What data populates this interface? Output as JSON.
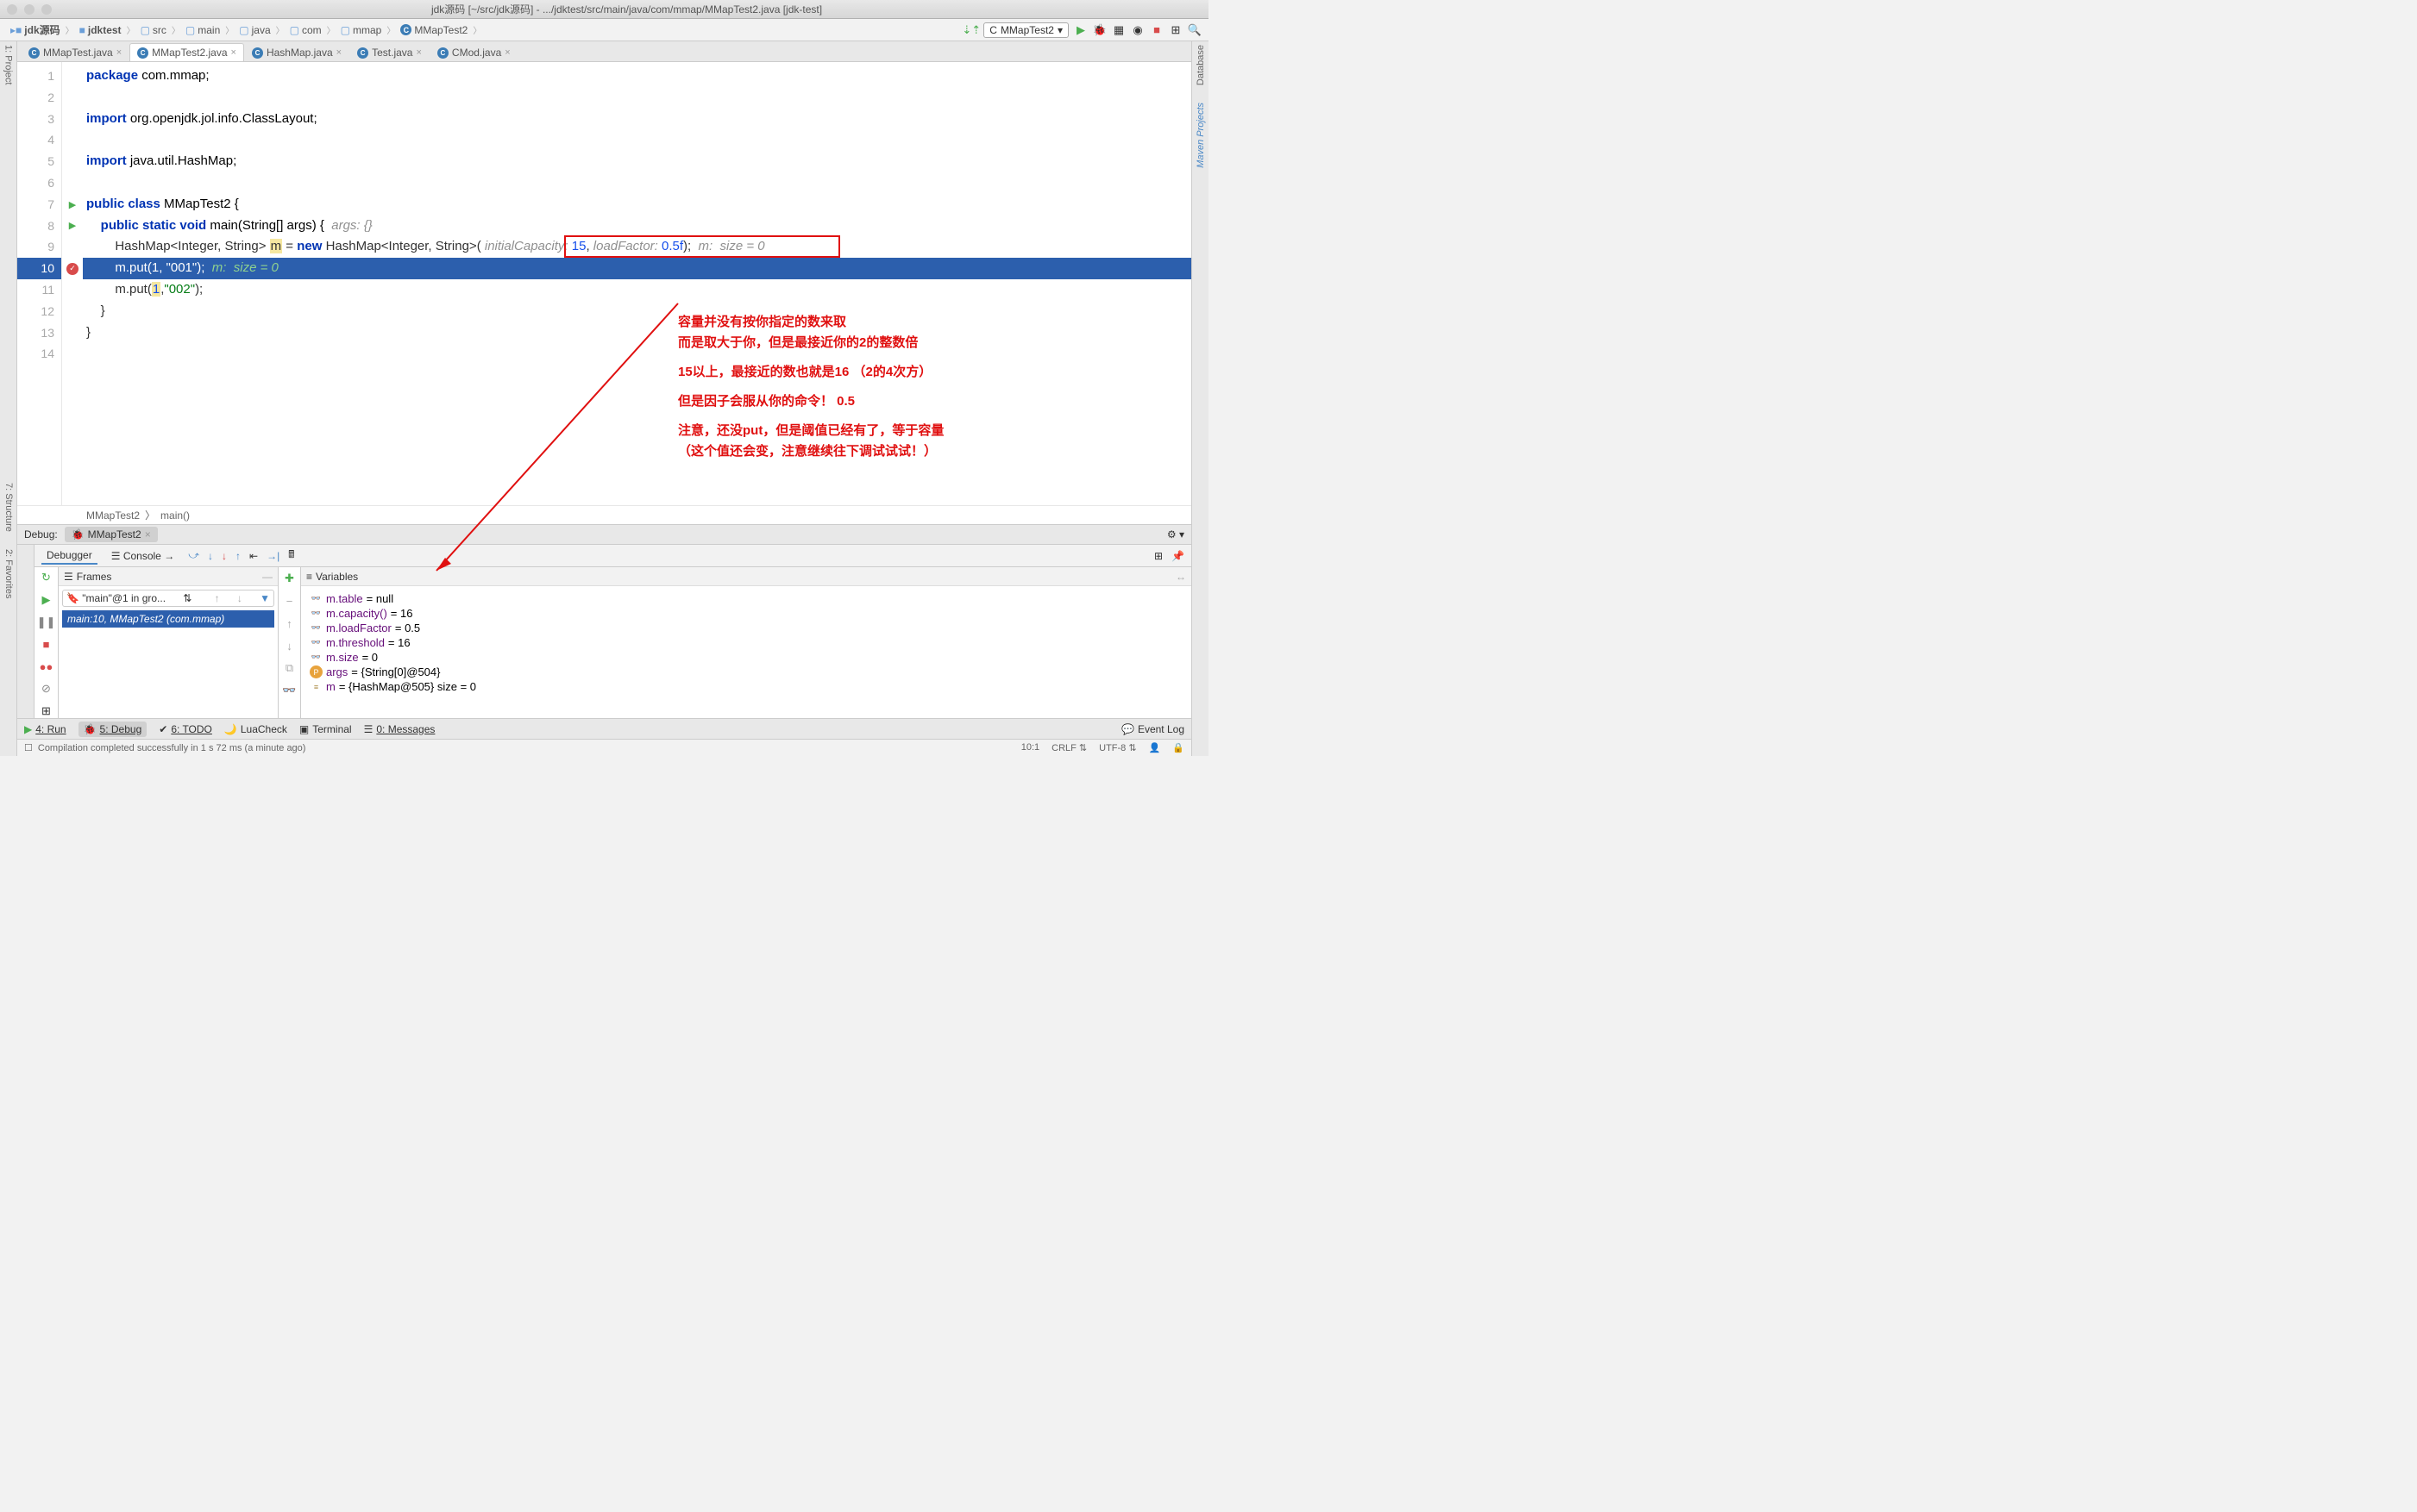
{
  "titlebar": {
    "title": "jdk源码 [~/src/jdk源码] - .../jdktest/src/main/java/com/mmap/MMapTest2.java [jdk-test]"
  },
  "breadcrumb": {
    "items": [
      "jdk源码",
      "jdktest",
      "src",
      "main",
      "java",
      "com",
      "mmap",
      "MMapTest2"
    ]
  },
  "run_config": "MMapTest2",
  "tabs": [
    {
      "label": "MMapTest.java",
      "active": false
    },
    {
      "label": "MMapTest2.java",
      "active": true
    },
    {
      "label": "HashMap.java",
      "active": false
    },
    {
      "label": "Test.java",
      "active": false
    },
    {
      "label": "CMod.java",
      "active": false
    }
  ],
  "side_tools": {
    "left": [
      "1: Project"
    ],
    "right": [
      "Database",
      "Maven Projects"
    ],
    "left_bottom": [
      "2: Favorites",
      "7: Structure"
    ]
  },
  "code": {
    "l1": "package com.mmap;",
    "l3": "import org.openjdk.jol.info.ClassLayout;",
    "l5": "import java.util.HashMap;",
    "l7": "public class MMapTest2 {",
    "l8_a": "    public static void main(String[] args) { ",
    "l8_hint": " args: {}",
    "l9_a": "        HashMap<Integer, String> ",
    "l9_m": "m",
    "l9_b": " = new HashMap<Integer, String>( ",
    "l9_hint1": "initialCapacity: ",
    "l9_v1": "15",
    "l9_c": ", ",
    "l9_hint2": "loadFactor: ",
    "l9_v2": "0.5f",
    "l9_d": ");  ",
    "l9_trail": "m:  size = 0",
    "l10_a": "        m.put(",
    "l10_n": "1",
    "l10_b": ", ",
    "l10_s": "\"001\"",
    "l10_c": ");  ",
    "l10_trail": "m:  size = 0",
    "l11_a": "        m.put(",
    "l11_n": "1",
    "l11_b": ",",
    "l11_s": "\"002\"",
    "l11_c": ");",
    "l12": "    }",
    "l13": "}"
  },
  "crumb2": {
    "a": "MMapTest2",
    "b": "main()"
  },
  "annotation": {
    "l1": "容量并没有按你指定的数来取",
    "l2": "而是取大于你，但是最接近你的2的整数倍",
    "l3": "15以上，最接近的数也就是16  （2的4次方）",
    "l4": "但是因子会服从你的命令！  0.5",
    "l5": "注意，还没put，但是阈值已经有了，等于容量",
    "l6": "（这个值还会变，注意继续往下调试试试！）"
  },
  "debug": {
    "label": "Debug:",
    "config": "MMapTest2",
    "debugger_tab": "Debugger",
    "console_tab": "Console",
    "frames_label": "Frames",
    "vars_label": "Variables",
    "thread": "\"main\"@1 in gro...",
    "frame": "main:10, MMapTest2 (com.mmap)",
    "vars": [
      {
        "icon": "glasses",
        "name": "m.table",
        "val": " = null"
      },
      {
        "icon": "glasses",
        "name": "m.capacity()",
        "val": " = 16"
      },
      {
        "icon": "glasses",
        "name": "m.loadFactor",
        "val": " = 0.5"
      },
      {
        "icon": "glasses",
        "name": "m.threshold",
        "val": " = 16"
      },
      {
        "icon": "glasses",
        "name": "m.size",
        "val": " = 0"
      },
      {
        "icon": "p",
        "name": "args",
        "val": " = {String[0]@504}"
      },
      {
        "icon": "eq",
        "name": "m",
        "val": " = {HashMap@505}  size = 0"
      }
    ]
  },
  "bottom_tabs": {
    "run": "4: Run",
    "debug": "5: Debug",
    "todo": "6: TODO",
    "luacheck": "LuaCheck",
    "terminal": "Terminal",
    "messages": "0: Messages",
    "eventlog": "Event Log"
  },
  "status": {
    "msg": "Compilation completed successfully in 1 s 72 ms (a minute ago)",
    "pos": "10:1",
    "lineend": "CRLF",
    "enc": "UTF-8"
  }
}
